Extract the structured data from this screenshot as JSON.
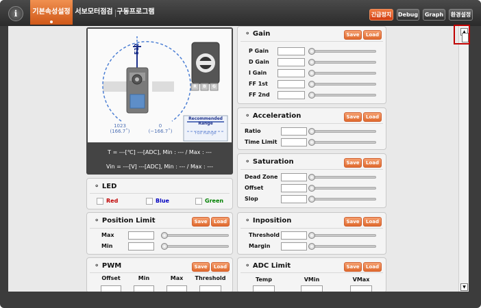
{
  "nav": {
    "tabs": [
      "기본속성설정",
      "서보모터점검",
      "구동프로그램"
    ],
    "buttons": {
      "emergency_stop": "긴급정지",
      "debug": "Debug",
      "graph": "Graph",
      "settings": "환경설정"
    }
  },
  "servo_view": {
    "top_value": "512",
    "left_value": "1023",
    "left_angle": "(166.7˚)",
    "right_value": "0",
    "right_angle": "(−166.7˚)",
    "rgb_letters": [
      "R",
      "B",
      "G"
    ],
    "legend_recommended": "Recommended Range",
    "legend_full": "Full Range",
    "temperature_readout": "T = ---[℃] ---[ADC], Min : --- / Max : ---",
    "voltage_readout": "Vin = ---[V] ---[ADC], Min : --- / Max : ---"
  },
  "common": {
    "save": "Save",
    "load": "Load"
  },
  "led": {
    "title": "LED",
    "red": "Red",
    "blue": "Blue",
    "green": "Green"
  },
  "position_limit": {
    "title": "Position Limit",
    "max": "Max",
    "min": "Min"
  },
  "pwm": {
    "title": "PWM",
    "columns": [
      "Offset",
      "Min",
      "Max",
      "Threshold"
    ]
  },
  "gain": {
    "title": "Gain",
    "rows": [
      "P Gain",
      "D Gain",
      "I Gain",
      "FF 1st",
      "FF 2nd"
    ]
  },
  "acceleration": {
    "title": "Acceleration",
    "rows": [
      "Ratio",
      "Time Limit"
    ]
  },
  "saturation": {
    "title": "Saturation",
    "rows": [
      "Dead Zone",
      "Offset",
      "Slop"
    ]
  },
  "inposition": {
    "title": "Inposition",
    "rows": [
      "Threshold",
      "Margin"
    ]
  },
  "adc_limit": {
    "title": "ADC Limit",
    "columns": [
      "Temp",
      "VMin",
      "VMax"
    ]
  },
  "colors": {
    "accent": "#e06a2e",
    "led_red": "#c00000",
    "led_blue": "#0000c0",
    "led_green": "#008000"
  }
}
